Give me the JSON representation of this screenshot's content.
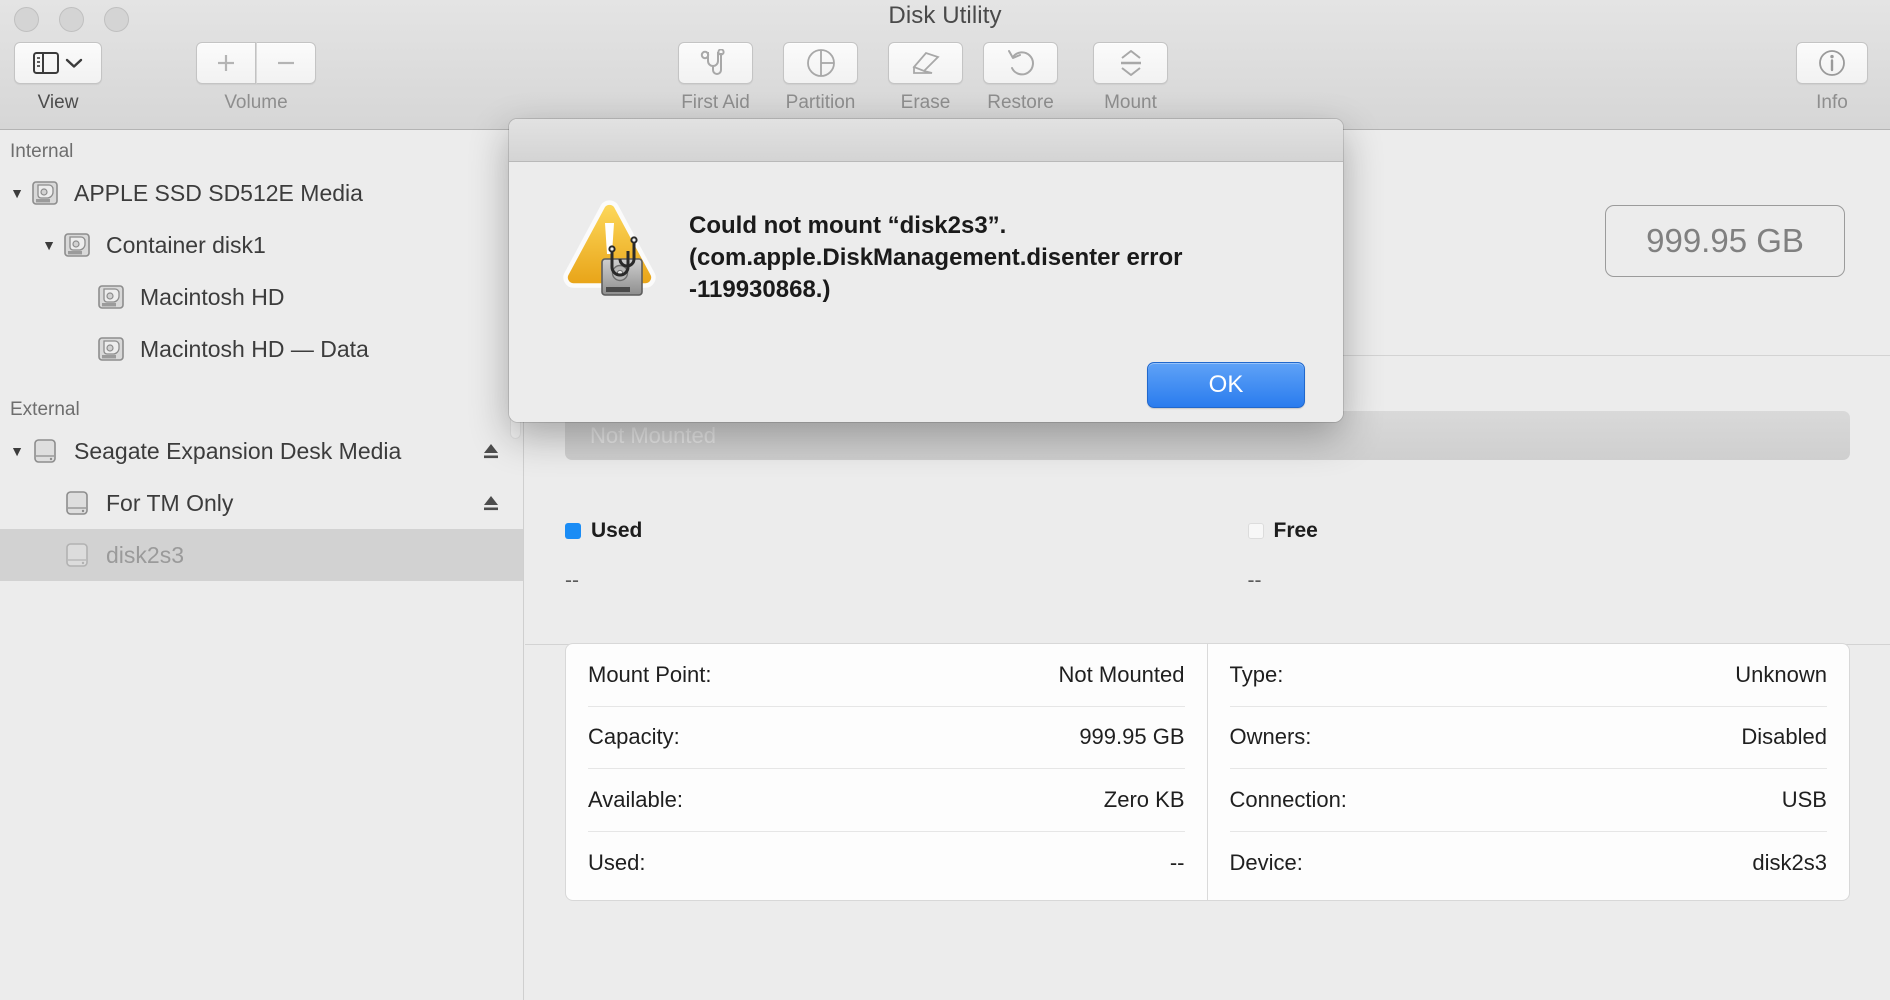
{
  "window": {
    "title": "Disk Utility",
    "traffic_lights": [
      "close-button",
      "minimize-button",
      "maximize-button"
    ]
  },
  "toolbar": {
    "view": {
      "label": "View",
      "icon": "sidebar-icon",
      "chevron": "chevron-down-icon",
      "enabled": true
    },
    "volume": {
      "label": "Volume",
      "add_icon": "plus-icon",
      "remove_icon": "minus-icon",
      "enabled": false
    },
    "actions": [
      {
        "label": "First Aid",
        "icon": "stethoscope-icon",
        "enabled": false
      },
      {
        "label": "Partition",
        "icon": "pie-chart-icon",
        "enabled": false
      },
      {
        "label": "Erase",
        "icon": "eraser-icon",
        "enabled": false
      },
      {
        "label": "Restore",
        "icon": "undo-arrow-icon",
        "enabled": false
      },
      {
        "label": "Mount",
        "icon": "mount-arrows-icon",
        "enabled": false
      }
    ],
    "info": {
      "label": "Info",
      "icon": "info-circle-icon",
      "enabled": true
    }
  },
  "sidebar": {
    "sections": [
      {
        "title": "Internal",
        "items": [
          {
            "label": "APPLE SSD SD512E Media",
            "icon": "internal-disk-icon",
            "indent": 0,
            "disclosure": "expanded",
            "eject": false,
            "selected": false
          },
          {
            "label": "Container disk1",
            "icon": "internal-disk-icon",
            "indent": 1,
            "disclosure": "expanded",
            "eject": false,
            "selected": false
          },
          {
            "label": "Macintosh HD",
            "icon": "internal-disk-icon",
            "indent": 2,
            "disclosure": "none",
            "eject": false,
            "selected": false
          },
          {
            "label": "Macintosh HD — Data",
            "icon": "internal-disk-icon",
            "indent": 2,
            "disclosure": "none",
            "eject": false,
            "selected": false
          }
        ]
      },
      {
        "title": "External",
        "items": [
          {
            "label": "Seagate Expansion Desk Media",
            "icon": "external-disk-icon",
            "indent": 0,
            "disclosure": "expanded",
            "eject": true,
            "selected": false
          },
          {
            "label": "For TM Only",
            "icon": "external-disk-icon",
            "indent": 1,
            "disclosure": "none",
            "eject": true,
            "selected": false
          },
          {
            "label": "disk2s3",
            "icon": "external-disk-icon",
            "indent": 1,
            "disclosure": "none",
            "eject": false,
            "selected": true
          }
        ]
      }
    ]
  },
  "main": {
    "capacity_badge": "999.95 GB",
    "capacity_bar_label": "Not Mounted",
    "legend": [
      {
        "label": "Used",
        "value": "--",
        "color": "#1a8cf5"
      },
      {
        "label": "Free",
        "value": "--",
        "color": "#f7f7f7"
      }
    ],
    "info_left": [
      {
        "key": "Mount Point:",
        "value": "Not Mounted"
      },
      {
        "key": "Capacity:",
        "value": "999.95 GB"
      },
      {
        "key": "Available:",
        "value": "Zero KB"
      },
      {
        "key": "Used:",
        "value": "--"
      }
    ],
    "info_right": [
      {
        "key": "Type:",
        "value": "Unknown"
      },
      {
        "key": "Owners:",
        "value": "Disabled"
      },
      {
        "key": "Connection:",
        "value": "USB"
      },
      {
        "key": "Device:",
        "value": "disk2s3"
      }
    ]
  },
  "dialog": {
    "icon": "warning-disk-stethoscope-icon",
    "message_line1": "Could not mount “disk2s3”.",
    "message_line2": "(com.apple.DiskManagement.disenter error",
    "message_line3": "-119930868.)",
    "ok_label": "OK",
    "accent_color": "#2a7cee",
    "warning_color": "#f5c242"
  }
}
